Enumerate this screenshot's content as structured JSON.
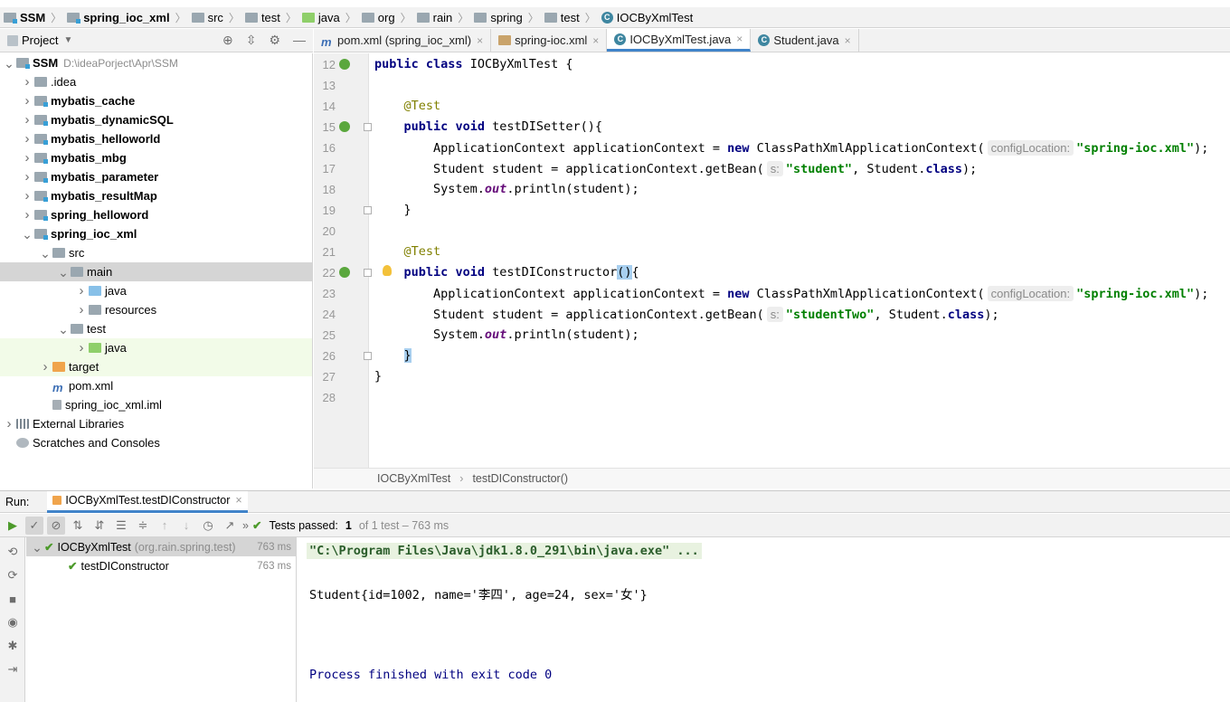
{
  "breadcrumb": [
    {
      "label": "SSM",
      "icon": "module-folder-icon",
      "bold": true
    },
    {
      "label": "spring_ioc_xml",
      "icon": "module-folder-icon",
      "bold": true
    },
    {
      "label": "src",
      "icon": "folder-icon"
    },
    {
      "label": "test",
      "icon": "folder-icon"
    },
    {
      "label": "java",
      "icon": "test-source-folder-icon"
    },
    {
      "label": "org",
      "icon": "package-icon"
    },
    {
      "label": "rain",
      "icon": "package-icon"
    },
    {
      "label": "spring",
      "icon": "package-icon"
    },
    {
      "label": "test",
      "icon": "package-icon"
    },
    {
      "label": "IOCByXmlTest",
      "icon": "class-icon"
    }
  ],
  "project_panel": {
    "title": "Project",
    "tree": [
      {
        "label": "SSM",
        "path": "D:\\ideaPorject\\Apr\\SSM",
        "depth": 0,
        "expanded": true,
        "icon": "module-folder-icon",
        "bold": true
      },
      {
        "label": ".idea",
        "depth": 1,
        "expanded": false,
        "icon": "folder-icon"
      },
      {
        "label": "mybatis_cache",
        "depth": 1,
        "expanded": false,
        "icon": "module-folder-icon",
        "bold": true
      },
      {
        "label": "mybatis_dynamicSQL",
        "depth": 1,
        "expanded": false,
        "icon": "module-folder-icon",
        "bold": true
      },
      {
        "label": "mybatis_helloworld",
        "depth": 1,
        "expanded": false,
        "icon": "module-folder-icon",
        "bold": true
      },
      {
        "label": "mybatis_mbg",
        "depth": 1,
        "expanded": false,
        "icon": "module-folder-icon",
        "bold": true
      },
      {
        "label": "mybatis_parameter",
        "depth": 1,
        "expanded": false,
        "icon": "module-folder-icon",
        "bold": true
      },
      {
        "label": "mybatis_resultMap",
        "depth": 1,
        "expanded": false,
        "icon": "module-folder-icon",
        "bold": true
      },
      {
        "label": "spring_helloword",
        "depth": 1,
        "expanded": false,
        "icon": "module-folder-icon",
        "bold": true
      },
      {
        "label": "spring_ioc_xml",
        "depth": 1,
        "expanded": true,
        "icon": "module-folder-icon",
        "bold": true
      },
      {
        "label": "src",
        "depth": 2,
        "expanded": true,
        "icon": "folder-icon"
      },
      {
        "label": "main",
        "depth": 3,
        "expanded": true,
        "icon": "folder-icon",
        "selected": true
      },
      {
        "label": "java",
        "depth": 4,
        "expanded": false,
        "icon": "source-folder-icon"
      },
      {
        "label": "resources",
        "depth": 4,
        "expanded": false,
        "icon": "resources-folder-icon"
      },
      {
        "label": "test",
        "depth": 3,
        "expanded": true,
        "icon": "folder-icon"
      },
      {
        "label": "java",
        "depth": 4,
        "expanded": false,
        "icon": "test-source-folder-icon",
        "highlight": true
      },
      {
        "label": "target",
        "depth": 2,
        "expanded": false,
        "icon": "excluded-folder-icon",
        "highlight2": true
      },
      {
        "label": "pom.xml",
        "depth": 2,
        "leaf": true,
        "icon": "maven-icon"
      },
      {
        "label": "spring_ioc_xml.iml",
        "depth": 2,
        "leaf": true,
        "icon": "iml-file-icon"
      },
      {
        "label": "External Libraries",
        "depth": 0,
        "expanded": false,
        "icon": "libraries-icon"
      },
      {
        "label": "Scratches and Consoles",
        "depth": 0,
        "leaf": true,
        "icon": "scratches-icon"
      }
    ]
  },
  "editor_tabs": [
    {
      "label": "pom.xml (spring_ioc_xml)",
      "icon": "maven-icon",
      "active": false
    },
    {
      "label": "spring-ioc.xml",
      "icon": "xml-file-icon",
      "active": false
    },
    {
      "label": "IOCByXmlTest.java",
      "icon": "class-icon",
      "active": true
    },
    {
      "label": "Student.java",
      "icon": "class-icon",
      "active": false
    }
  ],
  "code_lines": [
    {
      "n": "12",
      "run": true,
      "tokens": [
        [
          "kw",
          "public"
        ],
        [
          "t",
          " "
        ],
        [
          "kw",
          "class"
        ],
        [
          "t",
          " IOCByXmlTest {"
        ]
      ]
    },
    {
      "n": "13",
      "tokens": []
    },
    {
      "n": "14",
      "tokens": [
        [
          "t",
          "    "
        ],
        [
          "ann",
          "@Test"
        ]
      ]
    },
    {
      "n": "15",
      "run": true,
      "fold": true,
      "tokens": [
        [
          "t",
          "    "
        ],
        [
          "kw",
          "public"
        ],
        [
          "t",
          " "
        ],
        [
          "kw",
          "void"
        ],
        [
          "t",
          " testDISetter(){"
        ]
      ]
    },
    {
      "n": "16",
      "tokens": [
        [
          "t",
          "        ApplicationContext applicationContext = "
        ],
        [
          "kw",
          "new"
        ],
        [
          "t",
          " ClassPathXmlApplicationContext("
        ],
        [
          "hint",
          "configLocation:"
        ],
        [
          "str",
          "\"spring-ioc.xml\""
        ],
        [
          "t",
          ");"
        ]
      ]
    },
    {
      "n": "17",
      "tokens": [
        [
          "t",
          "        Student student = applicationContext.getBean("
        ],
        [
          "hint",
          "s:"
        ],
        [
          "str",
          "\"student\""
        ],
        [
          "t",
          ", Student."
        ],
        [
          "kw",
          "class"
        ],
        [
          "t",
          ");"
        ]
      ]
    },
    {
      "n": "18",
      "tokens": [
        [
          "t",
          "        System."
        ],
        [
          "static",
          "out"
        ],
        [
          "t",
          ".println(student);"
        ]
      ]
    },
    {
      "n": "19",
      "fold": true,
      "tokens": [
        [
          "t",
          "    }"
        ]
      ]
    },
    {
      "n": "20",
      "tokens": []
    },
    {
      "n": "21",
      "tokens": [
        [
          "t",
          "    "
        ],
        [
          "ann",
          "@Test"
        ]
      ]
    },
    {
      "n": "22",
      "run": true,
      "fold": true,
      "bulb": true,
      "tokens": [
        [
          "t",
          "    "
        ],
        [
          "kw",
          "public"
        ],
        [
          "t",
          " "
        ],
        [
          "kw",
          "void"
        ],
        [
          "t",
          " testDIConstructor"
        ],
        [
          "bracket",
          "()"
        ],
        [
          "t",
          "{"
        ]
      ]
    },
    {
      "n": "23",
      "tokens": [
        [
          "t",
          "        ApplicationContext applicationContext = "
        ],
        [
          "kw",
          "new"
        ],
        [
          "t",
          " ClassPathXmlApplicationContext("
        ],
        [
          "hint",
          "configLocation:"
        ],
        [
          "str",
          "\"spring-ioc.xml\""
        ],
        [
          "t",
          ");"
        ]
      ]
    },
    {
      "n": "24",
      "tokens": [
        [
          "t",
          "        Student student = applicationContext.getBean("
        ],
        [
          "hint",
          "s:"
        ],
        [
          "str",
          "\"studentTwo\""
        ],
        [
          "t",
          ", Student."
        ],
        [
          "kw",
          "class"
        ],
        [
          "t",
          ");"
        ]
      ]
    },
    {
      "n": "25",
      "tokens": [
        [
          "t",
          "        System."
        ],
        [
          "static",
          "out"
        ],
        [
          "t",
          ".println(student);"
        ]
      ]
    },
    {
      "n": "26",
      "fold": true,
      "tokens": [
        [
          "t",
          "    "
        ],
        [
          "bracket",
          "}"
        ]
      ]
    },
    {
      "n": "27",
      "tokens": [
        [
          "t",
          "}"
        ]
      ]
    },
    {
      "n": "28",
      "tokens": []
    }
  ],
  "editor_breadcrumb": [
    "IOCByXmlTest",
    "testDIConstructor()"
  ],
  "run_panel": {
    "label": "Run:",
    "tab_label": "IOCByXmlTest.testDIConstructor",
    "status_prefix": "Tests passed:",
    "status_count": "1",
    "status_suffix": "of 1 test – 763 ms",
    "test_tree": [
      {
        "label": "IOCByXmlTest",
        "detail": "(org.rain.spring.test)",
        "time": "763 ms",
        "depth": 0,
        "selected": true
      },
      {
        "label": "testDIConstructor",
        "detail": "",
        "time": "763 ms",
        "depth": 1,
        "selected": false
      }
    ],
    "console": [
      "\"C:\\Program Files\\Java\\jdk1.8.0_291\\bin\\java.exe\" ...",
      "Student{id=1002, name='李四', age=24, sex='女'}",
      "Process finished with exit code 0"
    ]
  },
  "colors": {
    "accent": "#4083c9",
    "pass": "#4c9a2a",
    "keyword": "#000080",
    "string": "#008000"
  }
}
